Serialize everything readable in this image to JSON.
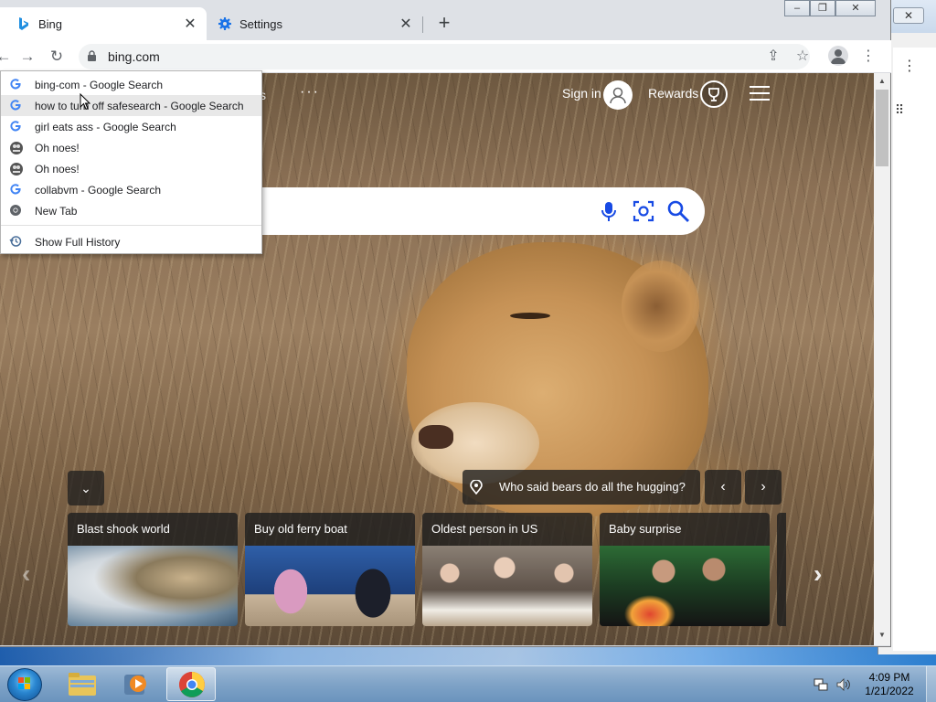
{
  "browser": {
    "tabs": [
      {
        "title": "Bing",
        "active": true
      },
      {
        "title": "Settings",
        "active": false
      }
    ],
    "url": "bing.com",
    "new_tab_label": "+",
    "tab_close_glyph": "✕"
  },
  "history_dropdown": {
    "items": [
      {
        "icon": "google-icon",
        "text": "bing-com - Google Search"
      },
      {
        "icon": "google-icon",
        "text": "how to turn off safesearch - Google Search",
        "hovered": true
      },
      {
        "icon": "google-icon",
        "text": "girl eats ass - Google Search"
      },
      {
        "icon": "page-icon",
        "text": "Oh noes!"
      },
      {
        "icon": "page-icon",
        "text": "Oh noes!"
      },
      {
        "icon": "google-icon",
        "text": "collabvm - Google Search"
      },
      {
        "icon": "chrome-icon",
        "text": "New Tab"
      }
    ],
    "show_full_history": "Show Full History"
  },
  "bing": {
    "header": {
      "partial_text": "s",
      "more": "···",
      "sign_in": "Sign in",
      "rewards": "Rewards"
    },
    "caption": "Who said bears do all the hugging?",
    "collapse_glyph": "⌄",
    "cards": [
      {
        "title": "Blast shook world"
      },
      {
        "title": "Buy old ferry boat"
      },
      {
        "title": "Oldest person in US"
      },
      {
        "title": "Baby surprise"
      }
    ]
  },
  "taskbar": {
    "time": "4:09 PM",
    "date": "1/21/2022"
  },
  "colors": {
    "chrome_frame": "#dee1e6",
    "bing_accent": "#174ae4",
    "taskbar": "#7fa3c7"
  }
}
